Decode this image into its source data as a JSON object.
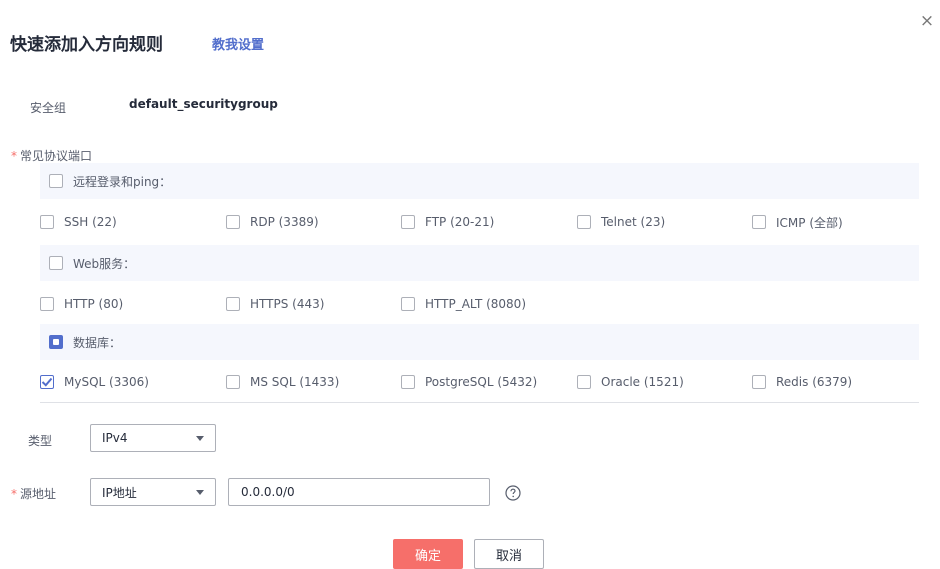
{
  "dialog": {
    "title": "快速添加入方向规则",
    "help_link": "教我设置",
    "close_glyph": "×"
  },
  "security_group": {
    "label": "安全组",
    "value": "default_securitygroup"
  },
  "protocols": {
    "label": "常见协议端口",
    "required_mark": "*",
    "remote": {
      "label": "远程登录和ping：",
      "state": "unchecked",
      "items": [
        {
          "label": "SSH (22)",
          "checked": false
        },
        {
          "label": "RDP (3389)",
          "checked": false
        },
        {
          "label": "FTP (20-21)",
          "checked": false
        },
        {
          "label": "Telnet (23)",
          "checked": false
        },
        {
          "label": "ICMP (全部)",
          "checked": false
        }
      ]
    },
    "web": {
      "label": "Web服务：",
      "state": "unchecked",
      "items": [
        {
          "label": "HTTP (80)",
          "checked": false
        },
        {
          "label": "HTTPS (443)",
          "checked": false
        },
        {
          "label": "HTTP_ALT (8080)",
          "checked": false
        }
      ]
    },
    "database": {
      "label": "数据库：",
      "state": "indeterminate",
      "items": [
        {
          "label": "MySQL (3306)",
          "checked": true
        },
        {
          "label": "MS SQL (1433)",
          "checked": false
        },
        {
          "label": "PostgreSQL (5432)",
          "checked": false
        },
        {
          "label": "Oracle (1521)",
          "checked": false
        },
        {
          "label": "Redis (6379)",
          "checked": false
        }
      ]
    }
  },
  "type": {
    "label": "类型",
    "value": "IPv4"
  },
  "source": {
    "label": "源地址",
    "required_mark": "*",
    "select_value": "IP地址",
    "input_value": "0.0.0.0/0"
  },
  "buttons": {
    "ok": "确定",
    "cancel": "取消"
  },
  "colors": {
    "accent": "#526ecc",
    "primary_button": "#f66f6a",
    "group_bg": "#f5f7fd",
    "required": "#f66f6a"
  }
}
